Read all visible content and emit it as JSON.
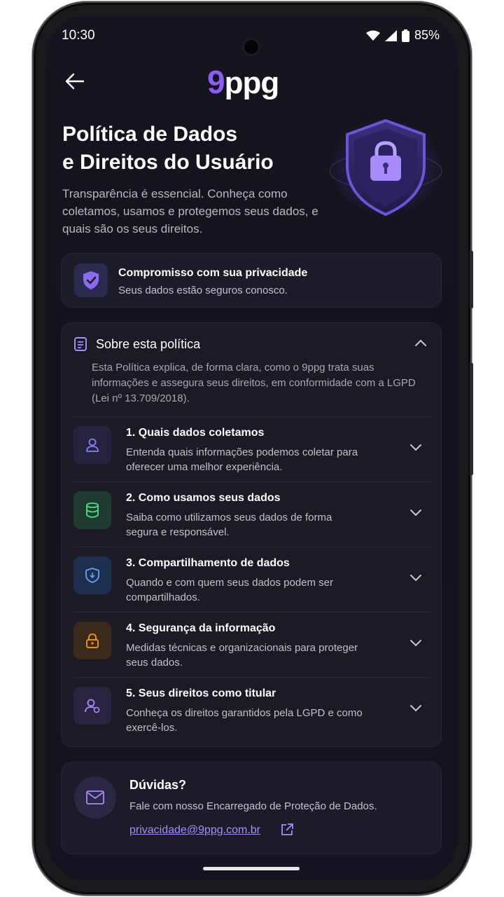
{
  "status_bar": {
    "time": "10:30",
    "battery_percent": "85%"
  },
  "header": {
    "logo_nine": "9",
    "logo_rest": "ppg"
  },
  "hero": {
    "title_line1": "Política de Dados",
    "title_line2": "e Direitos do Usuário",
    "subtitle": "Transparência é essencial. Conheça como coletamos, usamos e protegemos seus dados, e quais são os seus direitos."
  },
  "privacy_card": {
    "title": "Compromisso com sua privacidade",
    "subtitle": "Seus dados estão seguros conosco."
  },
  "policy": {
    "title": "Sobre esta política",
    "description": "Esta Política explica, de forma clara, como o 9ppg trata suas informações e assegura seus direitos, em conformidade com a LGPD (Lei nº 13.709/2018).",
    "items": [
      {
        "title": "1. Quais dados coletamos",
        "description": "Entenda quais informações podemos coletar para oferecer uma melhor experiência.",
        "icon": "user-icon",
        "color": "#8b7cf6"
      },
      {
        "title": "2. Como usamos seus dados",
        "description": "Saiba como utilizamos seus dados de forma segura e responsável.",
        "icon": "database-icon",
        "color": "#4ade80"
      },
      {
        "title": "3. Compartilhamento de dados",
        "description": "Quando e com quem seus dados podem ser compartilhados.",
        "icon": "shield-share-icon",
        "color": "#60a5fa"
      },
      {
        "title": "4. Segurança da informação",
        "description": "Medidas técnicas e organizacionais para proteger seus dados.",
        "icon": "lock-icon",
        "color": "#f59e0b"
      },
      {
        "title": "5. Seus direitos como titular",
        "description": "Conheça os direitos garantidos pela LGPD e como exercê-los.",
        "icon": "user-rights-icon",
        "color": "#a78bfa"
      }
    ]
  },
  "contact": {
    "title": "Dúvidas?",
    "subtitle": "Fale com nosso Encarregado de Proteção de Dados.",
    "email": "privacidade@9ppg.com.br"
  },
  "colors": {
    "accent": "#8b5cf6",
    "background": "#14141e",
    "card": "#1c1c28"
  }
}
